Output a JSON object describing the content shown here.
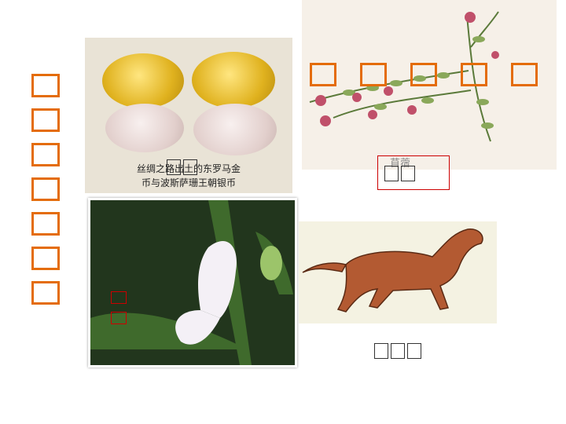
{
  "coins": {
    "caption_line1": "丝绸之路出土的东罗马金",
    "caption_line2": "币与波斯萨珊王朝银币"
  },
  "plant": {
    "label": "苜蓿"
  },
  "colors": {
    "accent_orange": "#e46c0a",
    "label_red": "#cc0000"
  }
}
